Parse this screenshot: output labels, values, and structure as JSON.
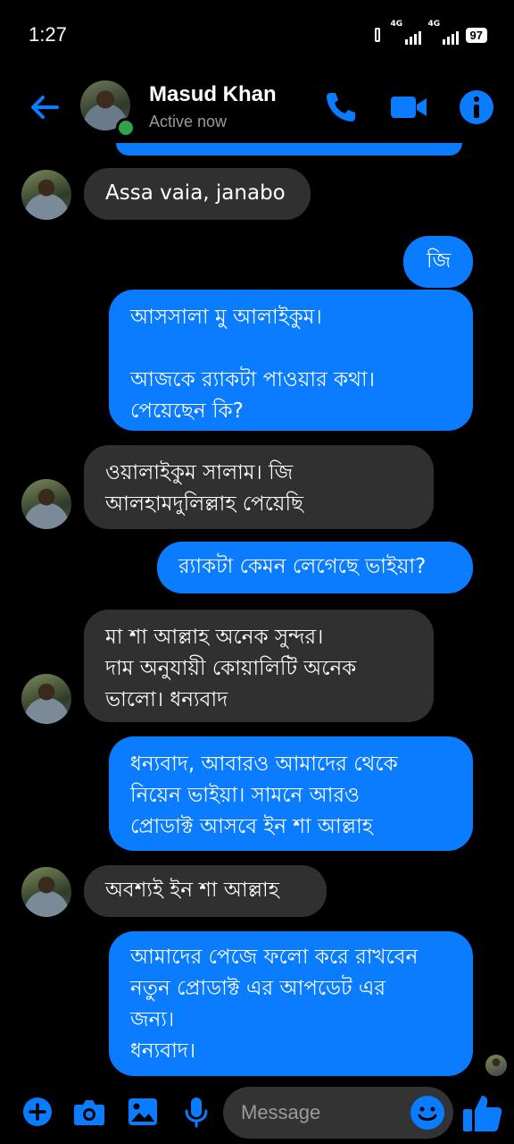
{
  "status_bar": {
    "time": "1:27",
    "network_1": "4G",
    "network_2": "4G",
    "battery": "97"
  },
  "header": {
    "contact_name": "Masud Khan",
    "contact_status": "Active now",
    "accent_color": "#0a7cff"
  },
  "messages": [
    {
      "direction": "incoming",
      "text": "Assa vaia,  janabo"
    },
    {
      "direction": "outgoing",
      "text": "জি"
    },
    {
      "direction": "outgoing",
      "text": "আসসালা মু আলাইকুম।\n\nআজকে র‍্যাকটা পাওয়ার কথা।\nপেয়েছেন কি?"
    },
    {
      "direction": "incoming",
      "text": "ওয়ালাইকুম সালাম। জি\nআলহামদুলিল্লাহ পেয়েছি"
    },
    {
      "direction": "outgoing",
      "text": "র‍্যাকটা কেমন লেগেছে ভাইয়া?"
    },
    {
      "direction": "incoming",
      "text": "মা শা আল্লাহ অনেক সুন্দর।\nদাম অনুযায়ী কোয়ালিটি অনেক\nভালো। ধন্যবাদ"
    },
    {
      "direction": "outgoing",
      "text": "ধন্যবাদ, আবারও আমাদের থেকে\nনিয়েন ভাইয়া। সামনে আরও\nপ্রোডাক্ট আসবে ইন শা আল্লাহ"
    },
    {
      "direction": "incoming",
      "text": "অবশ্যই ইন শা আল্লাহ"
    },
    {
      "direction": "outgoing",
      "text": "আমাদের পেজে ফলো করে রাখবেন\nনতুন প্রোডাক্ট এর আপডেট এর\nজন্য।\nধন্যবাদ।"
    }
  ],
  "composer": {
    "placeholder": "Message",
    "icons": [
      "plus-icon",
      "camera-icon",
      "gallery-icon",
      "microphone-icon",
      "emoji-icon",
      "thumbs-up-icon"
    ]
  }
}
